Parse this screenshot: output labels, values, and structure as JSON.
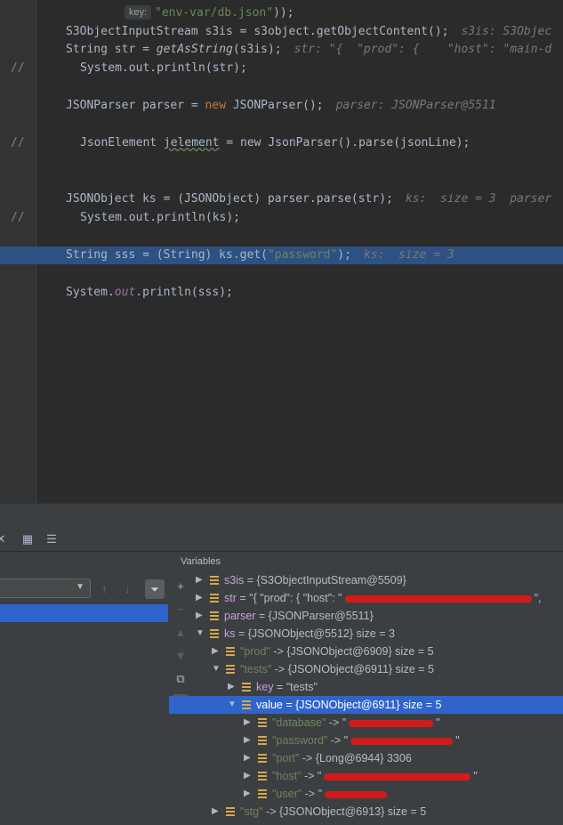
{
  "editor": {
    "hint_key_label": "key:",
    "lines": [
      {
        "id": "l0",
        "comment": false,
        "parts": [
          {
            "t": "\"env-var/db.json\"",
            "c": "str"
          },
          {
            "t": "));",
            "c": "plain"
          }
        ]
      },
      {
        "id": "l1",
        "comment": false,
        "parts": [
          {
            "t": "S3ObjectInputStream s3is = s3object.getObjectContent();",
            "c": "plain"
          },
          {
            "t": "s3is: S3Objec",
            "c": "inlay"
          }
        ]
      },
      {
        "id": "l2",
        "comment": false,
        "parts": [
          {
            "t": "String str = ",
            "c": "plain"
          },
          {
            "t": "getAsString",
            "c": "fn-static"
          },
          {
            "t": "(s3is);",
            "c": "plain"
          },
          {
            "t": "str: \"{  \"prod\": {    \"host\": \"main-d",
            "c": "inlay"
          }
        ]
      },
      {
        "id": "l3",
        "comment": true,
        "parts": [
          {
            "t": "System.out.println(str);",
            "c": "plain"
          }
        ]
      },
      {
        "id": "l4",
        "comment": false,
        "parts": [
          {
            "t": "JSONParser parser = ",
            "c": "plain"
          },
          {
            "t": "new ",
            "c": "kw"
          },
          {
            "t": "JSONParser();",
            "c": "plain"
          },
          {
            "t": "parser: JSONParser@5511",
            "c": "inlay"
          }
        ]
      },
      {
        "id": "l5",
        "comment": true,
        "parts": [
          {
            "t": "JsonElement ",
            "c": "plain"
          },
          {
            "t": "jelement",
            "c": "squig"
          },
          {
            "t": " = new JsonParser().parse(jsonLine);",
            "c": "plain"
          }
        ]
      },
      {
        "id": "l6",
        "comment": false,
        "parts": [
          {
            "t": "JSONObject ks = (JSONObject) parser.parse(str);",
            "c": "plain"
          },
          {
            "t": "ks:  size = 3  parser",
            "c": "inlay"
          }
        ]
      },
      {
        "id": "l7",
        "comment": true,
        "parts": [
          {
            "t": "System.out.println(ks);",
            "c": "plain"
          }
        ]
      },
      {
        "id": "l8",
        "comment": false,
        "parts": [
          {
            "t": "String sss = (String) ks.get(",
            "c": "plain"
          },
          {
            "t": "\"password\"",
            "c": "str"
          },
          {
            "t": ");",
            "c": "plain"
          },
          {
            "t": "ks:  size = 3",
            "c": "inlay"
          }
        ]
      },
      {
        "id": "l9",
        "comment": false,
        "parts": [
          {
            "t": "System.",
            "c": "plain"
          },
          {
            "t": "out",
            "c": "field"
          },
          {
            "t": ".println(sss);",
            "c": "plain"
          }
        ]
      }
    ],
    "comment_mark": "//"
  },
  "debugger": {
    "variables_title": "Variables",
    "variables": [
      {
        "id": "v0",
        "arrow": "▶",
        "name": "s3is",
        "value": " = {S3ObjectInputStream@5509}",
        "redact": 0
      },
      {
        "id": "v1",
        "arrow": "▶",
        "name": "str",
        "value": " = \"{  \"prod\": {   \"host\": \"",
        "redact": 210,
        "tail": "\","
      },
      {
        "id": "v2",
        "arrow": "▶",
        "name": "parser",
        "value": " = {JSONParser@5511}",
        "redact": 0
      },
      {
        "id": "v3",
        "arrow": "▼",
        "name": "ks",
        "value": " = {JSONObject@5512}  size = 3",
        "redact": 0
      },
      {
        "id": "v4",
        "arrow": "▶",
        "key": "\"prod\"",
        "value": " -> {JSONObject@6909}  size = 5",
        "redact": 0
      },
      {
        "id": "v5",
        "arrow": "▼",
        "key": "\"tests\"",
        "value": " -> {JSONObject@6911}  size = 5",
        "redact": 0
      },
      {
        "id": "v6",
        "arrow": "▶",
        "name": "key",
        "value": " = \"tests\"",
        "redact": 0
      },
      {
        "id": "v7",
        "arrow": "▼",
        "name": "value",
        "value": " = {JSONObject@6911}  size = 5",
        "redact": 0,
        "selected": true
      },
      {
        "id": "v8",
        "arrow": "▶",
        "key": "\"database\"",
        "value": " -> \"",
        "redact": 95,
        "tail": "\""
      },
      {
        "id": "v9",
        "arrow": "▶",
        "key": "\"password\"",
        "value": " -> \"",
        "redact": 115,
        "tail": "\""
      },
      {
        "id": "v10",
        "arrow": "▶",
        "key": "\"port\"",
        "value": " -> {Long@6944} 3306",
        "redact": 0
      },
      {
        "id": "v11",
        "arrow": "▶",
        "key": "\"host\"",
        "value": " -> \"",
        "redact": 165,
        "tail": "\""
      },
      {
        "id": "v12",
        "arrow": "▶",
        "key": "\"user\"",
        "value": " -> \"",
        "redact": 70,
        "tail": ""
      },
      {
        "id": "v13",
        "arrow": "▶",
        "key": "\"stg\"",
        "value": " -> {JSONObject@6913}  size = 5",
        "redact": 0
      }
    ]
  },
  "colors": {
    "selection": "#2f65ca",
    "highlight_line": "#2d5183",
    "redaction": "#d11b1b"
  },
  "icons": [
    "close-icon",
    "table-icon",
    "columns-icon",
    "chevron-down-icon",
    "arrow-up-icon",
    "arrow-down-icon",
    "filter-icon",
    "add-watch-icon",
    "remove-icon",
    "move-up-icon",
    "move-down-icon",
    "copy-icon",
    "glasses-icon",
    "field-icon"
  ]
}
